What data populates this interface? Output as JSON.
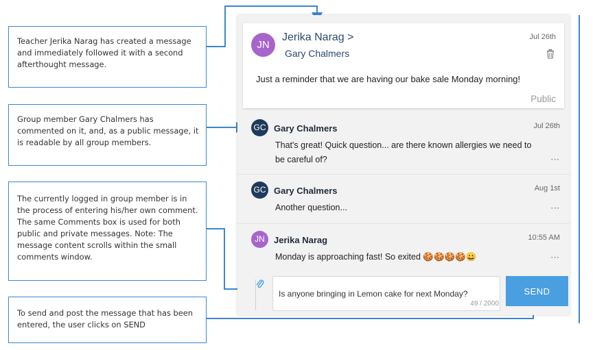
{
  "callouts": {
    "c1": "Teacher Jerika Narag has created a message and immediately followed it with a second afterthought message.",
    "c2": "Group member Gary Chalmers has commented on it, and, as a public message, it is readable by all group members.",
    "c3": "The currently logged in group member is in the process of entering his/her own comment. The same Comments box is used for both public and private messages. Note: The message content scrolls within the small comments window.",
    "c4": "To send and post the message that has been entered, the user clicks on SEND"
  },
  "message": {
    "avatar_initials": "JN",
    "sender": "Jerika Narag >",
    "recipient": "Gary Chalmers",
    "date": "Jul 26th",
    "body": "Just a reminder that we are having our bake sale Monday morning!",
    "visibility": "Public"
  },
  "comments": [
    {
      "initials": "GC",
      "name": "Gary Chalmers",
      "date": "Jul 26th",
      "text": "That's great! Quick question... are there known allergies we need to be careful of?",
      "more": "···"
    },
    {
      "initials": "GC",
      "name": "Gary Chalmers",
      "date": "Aug 1st",
      "text": "Another question...",
      "more": "···"
    },
    {
      "initials": "JN",
      "name": "Jerika Narag",
      "date": "10:55 AM",
      "text": "Monday is approaching fast! So exited 🍪🍪🍪🍪😀",
      "more": "···"
    }
  ],
  "compose": {
    "input_value": "Is anyone bringing in Lemon cake for next Monday?",
    "counter": "49 / 2000",
    "send_label": "SEND"
  },
  "colors": {
    "accent": "#3b86cf",
    "send_button": "#4a9fe0",
    "avatar_teacher": "#a765cc",
    "avatar_member": "#1f3a5c"
  },
  "icons": {
    "attach": "paperclip-icon",
    "delete": "trash-icon",
    "more": "more-options-icon"
  }
}
